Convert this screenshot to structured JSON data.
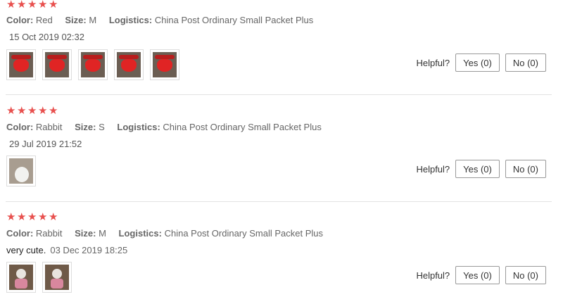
{
  "reviews": [
    {
      "stars": 5,
      "color_label": "Color:",
      "color": "Red",
      "size_label": "Size:",
      "size": "M",
      "logistics_label": "Logistics:",
      "logistics": "China Post Ordinary Small Packet Plus",
      "comment": "",
      "date": "15 Oct 2019 02:32",
      "images": [
        "red-item-photo",
        "red-item-photo",
        "red-item-photo",
        "red-item-photo",
        "red-item-photo"
      ],
      "helpful_label": "Helpful?",
      "yes_label": "Yes (0)",
      "no_label": "No (0)"
    },
    {
      "stars": 5,
      "color_label": "Color:",
      "color": "Rabbit",
      "size_label": "Size:",
      "size": "S",
      "logistics_label": "Logistics:",
      "logistics": "China Post Ordinary Small Packet Plus",
      "comment": "",
      "date": "29 Jul 2019 21:52",
      "images": [
        "rabbit-item-photo"
      ],
      "helpful_label": "Helpful?",
      "yes_label": "Yes (0)",
      "no_label": "No (0)"
    },
    {
      "stars": 5,
      "color_label": "Color:",
      "color": "Rabbit",
      "size_label": "Size:",
      "size": "M",
      "logistics_label": "Logistics:",
      "logistics": "China Post Ordinary Small Packet Plus",
      "comment": "very cute.",
      "date": "03 Dec 2019 18:25",
      "images": [
        "doll-item-photo",
        "doll-item-photo"
      ],
      "helpful_label": "Helpful?",
      "yes_label": "Yes (0)",
      "no_label": "No (0)"
    }
  ],
  "colors": {
    "star": "#e8504e",
    "divider": "#e3e3e3"
  }
}
